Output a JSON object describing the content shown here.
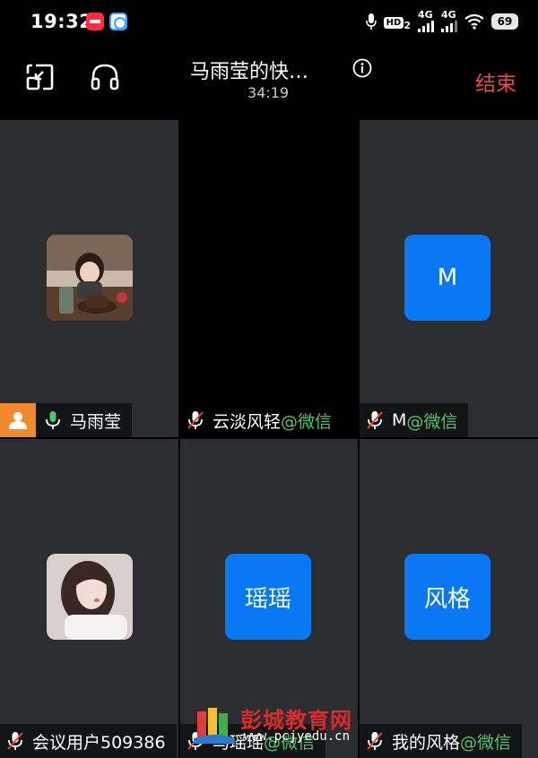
{
  "status_bar": {
    "time": "19:32",
    "hd": "HD",
    "hd_sub": "2",
    "net1": "4G",
    "net2": "4G",
    "battery": "69"
  },
  "header": {
    "title": "马雨莹的快…",
    "timer": "34:19",
    "end_label": "结束"
  },
  "participants": [
    {
      "name": "马雨莹",
      "suffix": "",
      "host": true,
      "mic": "on",
      "avatar": "photo"
    },
    {
      "name": "云淡风轻",
      "suffix": "@微信",
      "host": false,
      "mic": "muted",
      "avatar": "none"
    },
    {
      "name": "M",
      "suffix": "@微信",
      "host": false,
      "mic": "muted",
      "avatar": "letter",
      "avatar_text": "M"
    },
    {
      "name": "会议用户509386",
      "suffix": "",
      "host": false,
      "mic": "muted",
      "avatar": "photo"
    },
    {
      "name": "马瑶瑶",
      "suffix": "@微信",
      "host": false,
      "mic": "muted",
      "avatar": "letter",
      "avatar_text": "瑶瑶"
    },
    {
      "name": "我的风格",
      "suffix": "@微信",
      "host": false,
      "mic": "muted",
      "avatar": "letter",
      "avatar_text": "风格"
    }
  ],
  "watermark": {
    "text": "彭城教育网",
    "url": "www.pcjyedu.cn"
  },
  "colors": {
    "accent_blue": "#0a78f4",
    "end_red": "#f04a3e",
    "wechat_green": "#4dc96b",
    "host_orange": "#f2892c",
    "tile_bg": "#2b2d31"
  }
}
